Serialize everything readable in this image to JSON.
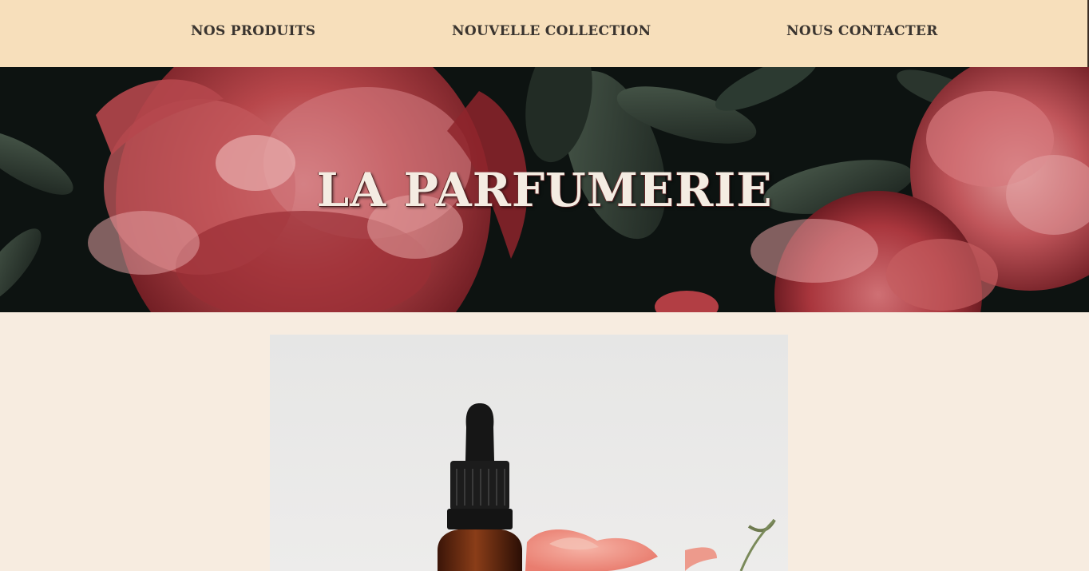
{
  "nav": {
    "items": [
      {
        "label": "NOS PRODUITS"
      },
      {
        "label": "NOUVELLE COLLECTION"
      },
      {
        "label": "NOUS CONTACTER"
      }
    ]
  },
  "hero": {
    "title": "LA PARFUMERIE",
    "image": "red-peony-flowers-dark-background"
  },
  "main": {
    "product_image": "amber-dropper-bottle-with-pink-rose"
  },
  "colors": {
    "nav_background": "#f7dfbb",
    "page_background": "#f7ece0",
    "nav_text": "#3a342f",
    "hero_title": "#f4ece2",
    "peony_red": "#b03a3e",
    "leaf_green": "#2e3a30"
  }
}
